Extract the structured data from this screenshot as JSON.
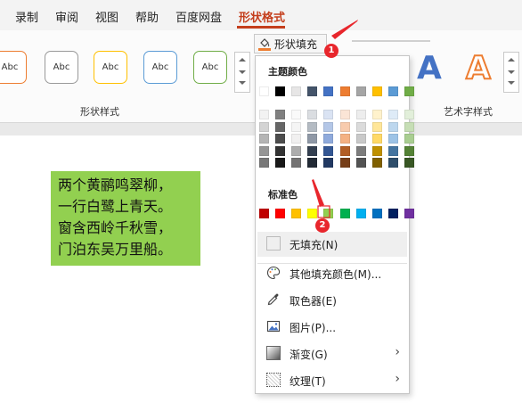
{
  "tabs": [
    "录制",
    "审阅",
    "视图",
    "帮助",
    "百度网盘",
    "形状格式"
  ],
  "ribbon": {
    "shape_style_label": "Abc",
    "shape_styles_group": "形状样式",
    "fill_button": "形状填充",
    "art_letter": "A",
    "art_styles_group": "艺术字样式"
  },
  "poem": [
    "两个黄鹂鸣翠柳，",
    "一行白鹭上青天。",
    "窗含西岭千秋雪，",
    "门泊东吴万里船。"
  ],
  "menu": {
    "theme_colors_title": "主题颜色",
    "theme_colors": [
      "#ffffff",
      "#000000",
      "#e7e6e6",
      "#44546a",
      "#4472c4",
      "#ed7d31",
      "#a5a5a5",
      "#ffc000",
      "#5b9bd5",
      "#70ad47"
    ],
    "standard_colors_title": "标准色",
    "standard_colors": [
      "#c00000",
      "#ff0000",
      "#ffc000",
      "#ffff00",
      "#92d050",
      "#00b050",
      "#00b0f0",
      "#0070c0",
      "#002060",
      "#7030a0"
    ],
    "items": {
      "no_fill": "无填充(N)",
      "more_colors": "其他填充颜色(M)...",
      "eyedropper": "取色器(E)",
      "picture": "图片(P)...",
      "gradient": "渐变(G)",
      "texture": "纹理(T)"
    }
  },
  "callouts": [
    "1",
    "2"
  ]
}
